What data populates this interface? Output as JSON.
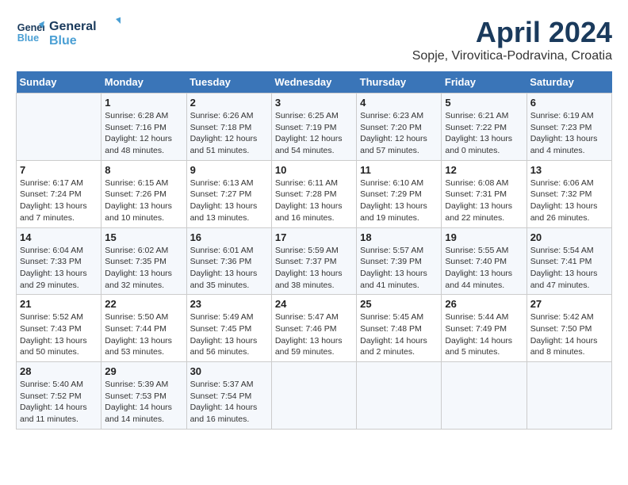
{
  "header": {
    "logo_line1": "General",
    "logo_line2": "Blue",
    "title": "April 2024",
    "subtitle": "Sopje, Virovitica-Podravina, Croatia"
  },
  "weekdays": [
    "Sunday",
    "Monday",
    "Tuesday",
    "Wednesday",
    "Thursday",
    "Friday",
    "Saturday"
  ],
  "weeks": [
    [
      {
        "day": "",
        "sunrise": "",
        "sunset": "",
        "daylight": ""
      },
      {
        "day": "1",
        "sunrise": "Sunrise: 6:28 AM",
        "sunset": "Sunset: 7:16 PM",
        "daylight": "Daylight: 12 hours and 48 minutes."
      },
      {
        "day": "2",
        "sunrise": "Sunrise: 6:26 AM",
        "sunset": "Sunset: 7:18 PM",
        "daylight": "Daylight: 12 hours and 51 minutes."
      },
      {
        "day": "3",
        "sunrise": "Sunrise: 6:25 AM",
        "sunset": "Sunset: 7:19 PM",
        "daylight": "Daylight: 12 hours and 54 minutes."
      },
      {
        "day": "4",
        "sunrise": "Sunrise: 6:23 AM",
        "sunset": "Sunset: 7:20 PM",
        "daylight": "Daylight: 12 hours and 57 minutes."
      },
      {
        "day": "5",
        "sunrise": "Sunrise: 6:21 AM",
        "sunset": "Sunset: 7:22 PM",
        "daylight": "Daylight: 13 hours and 0 minutes."
      },
      {
        "day": "6",
        "sunrise": "Sunrise: 6:19 AM",
        "sunset": "Sunset: 7:23 PM",
        "daylight": "Daylight: 13 hours and 4 minutes."
      }
    ],
    [
      {
        "day": "7",
        "sunrise": "Sunrise: 6:17 AM",
        "sunset": "Sunset: 7:24 PM",
        "daylight": "Daylight: 13 hours and 7 minutes."
      },
      {
        "day": "8",
        "sunrise": "Sunrise: 6:15 AM",
        "sunset": "Sunset: 7:26 PM",
        "daylight": "Daylight: 13 hours and 10 minutes."
      },
      {
        "day": "9",
        "sunrise": "Sunrise: 6:13 AM",
        "sunset": "Sunset: 7:27 PM",
        "daylight": "Daylight: 13 hours and 13 minutes."
      },
      {
        "day": "10",
        "sunrise": "Sunrise: 6:11 AM",
        "sunset": "Sunset: 7:28 PM",
        "daylight": "Daylight: 13 hours and 16 minutes."
      },
      {
        "day": "11",
        "sunrise": "Sunrise: 6:10 AM",
        "sunset": "Sunset: 7:29 PM",
        "daylight": "Daylight: 13 hours and 19 minutes."
      },
      {
        "day": "12",
        "sunrise": "Sunrise: 6:08 AM",
        "sunset": "Sunset: 7:31 PM",
        "daylight": "Daylight: 13 hours and 22 minutes."
      },
      {
        "day": "13",
        "sunrise": "Sunrise: 6:06 AM",
        "sunset": "Sunset: 7:32 PM",
        "daylight": "Daylight: 13 hours and 26 minutes."
      }
    ],
    [
      {
        "day": "14",
        "sunrise": "Sunrise: 6:04 AM",
        "sunset": "Sunset: 7:33 PM",
        "daylight": "Daylight: 13 hours and 29 minutes."
      },
      {
        "day": "15",
        "sunrise": "Sunrise: 6:02 AM",
        "sunset": "Sunset: 7:35 PM",
        "daylight": "Daylight: 13 hours and 32 minutes."
      },
      {
        "day": "16",
        "sunrise": "Sunrise: 6:01 AM",
        "sunset": "Sunset: 7:36 PM",
        "daylight": "Daylight: 13 hours and 35 minutes."
      },
      {
        "day": "17",
        "sunrise": "Sunrise: 5:59 AM",
        "sunset": "Sunset: 7:37 PM",
        "daylight": "Daylight: 13 hours and 38 minutes."
      },
      {
        "day": "18",
        "sunrise": "Sunrise: 5:57 AM",
        "sunset": "Sunset: 7:39 PM",
        "daylight": "Daylight: 13 hours and 41 minutes."
      },
      {
        "day": "19",
        "sunrise": "Sunrise: 5:55 AM",
        "sunset": "Sunset: 7:40 PM",
        "daylight": "Daylight: 13 hours and 44 minutes."
      },
      {
        "day": "20",
        "sunrise": "Sunrise: 5:54 AM",
        "sunset": "Sunset: 7:41 PM",
        "daylight": "Daylight: 13 hours and 47 minutes."
      }
    ],
    [
      {
        "day": "21",
        "sunrise": "Sunrise: 5:52 AM",
        "sunset": "Sunset: 7:43 PM",
        "daylight": "Daylight: 13 hours and 50 minutes."
      },
      {
        "day": "22",
        "sunrise": "Sunrise: 5:50 AM",
        "sunset": "Sunset: 7:44 PM",
        "daylight": "Daylight: 13 hours and 53 minutes."
      },
      {
        "day": "23",
        "sunrise": "Sunrise: 5:49 AM",
        "sunset": "Sunset: 7:45 PM",
        "daylight": "Daylight: 13 hours and 56 minutes."
      },
      {
        "day": "24",
        "sunrise": "Sunrise: 5:47 AM",
        "sunset": "Sunset: 7:46 PM",
        "daylight": "Daylight: 13 hours and 59 minutes."
      },
      {
        "day": "25",
        "sunrise": "Sunrise: 5:45 AM",
        "sunset": "Sunset: 7:48 PM",
        "daylight": "Daylight: 14 hours and 2 minutes."
      },
      {
        "day": "26",
        "sunrise": "Sunrise: 5:44 AM",
        "sunset": "Sunset: 7:49 PM",
        "daylight": "Daylight: 14 hours and 5 minutes."
      },
      {
        "day": "27",
        "sunrise": "Sunrise: 5:42 AM",
        "sunset": "Sunset: 7:50 PM",
        "daylight": "Daylight: 14 hours and 8 minutes."
      }
    ],
    [
      {
        "day": "28",
        "sunrise": "Sunrise: 5:40 AM",
        "sunset": "Sunset: 7:52 PM",
        "daylight": "Daylight: 14 hours and 11 minutes."
      },
      {
        "day": "29",
        "sunrise": "Sunrise: 5:39 AM",
        "sunset": "Sunset: 7:53 PM",
        "daylight": "Daylight: 14 hours and 14 minutes."
      },
      {
        "day": "30",
        "sunrise": "Sunrise: 5:37 AM",
        "sunset": "Sunset: 7:54 PM",
        "daylight": "Daylight: 14 hours and 16 minutes."
      },
      {
        "day": "",
        "sunrise": "",
        "sunset": "",
        "daylight": ""
      },
      {
        "day": "",
        "sunrise": "",
        "sunset": "",
        "daylight": ""
      },
      {
        "day": "",
        "sunrise": "",
        "sunset": "",
        "daylight": ""
      },
      {
        "day": "",
        "sunrise": "",
        "sunset": "",
        "daylight": ""
      }
    ]
  ]
}
